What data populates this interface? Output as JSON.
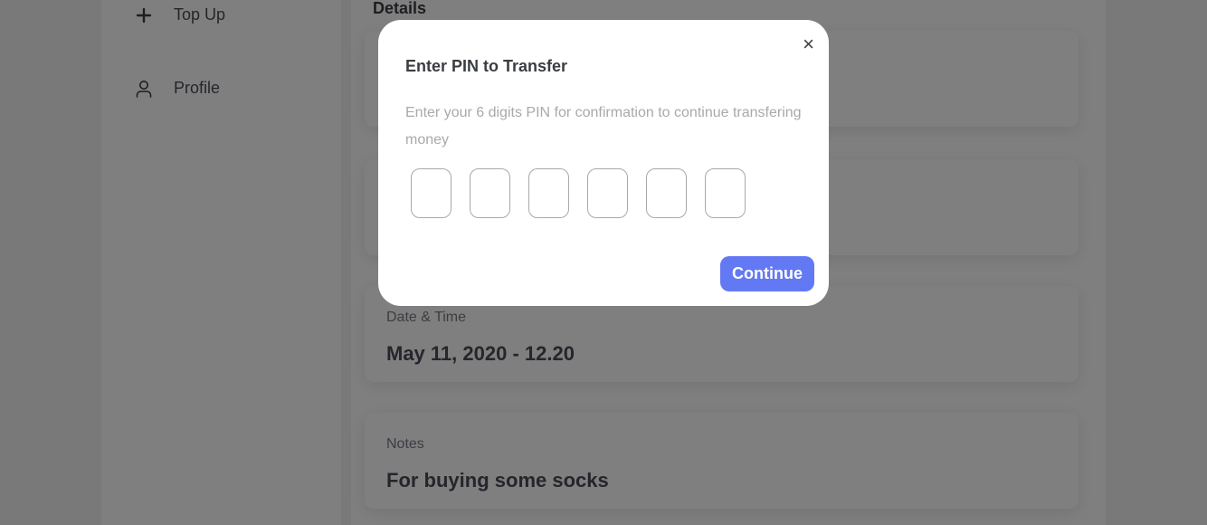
{
  "sidebar": {
    "items": [
      {
        "label": "Top Up",
        "icon": "plus-icon"
      },
      {
        "label": "Profile",
        "icon": "user-icon"
      }
    ]
  },
  "details": {
    "title": "Details",
    "cards": [
      {
        "label": "Date & Time",
        "value": "May 11, 2020 - 12.20"
      },
      {
        "label": "Notes",
        "value": "For buying some socks"
      }
    ]
  },
  "modal": {
    "close_label": "×",
    "title": "Enter PIN to Transfer",
    "description": "Enter your 6 digits PIN for confirmation to continue transfering money",
    "pin_length": 6,
    "continue_label": "Continue"
  },
  "colors": {
    "accent": "#6379f4",
    "overlay": "rgba(0,0,0,0.5)"
  }
}
